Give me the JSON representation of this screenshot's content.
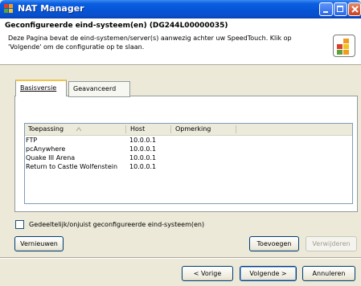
{
  "window": {
    "title": "NAT Manager"
  },
  "header": {
    "title": "Geconfigureerde eind-systeem(en) (DG244L00000035)",
    "description": "Deze Pagina bevat de eind-systemen/server(s) aanwezig achter uw SpeedTouch. Klik op 'Volgende' om de configuratie op te slaan."
  },
  "tabs": [
    {
      "label": "Basisversie",
      "active": true
    },
    {
      "label": "Geavanceerd",
      "active": false
    }
  ],
  "table": {
    "columns": [
      "Toepassing",
      "Host",
      "Opmerking"
    ],
    "rows": [
      {
        "app": "FTP",
        "host": "10.0.0.1",
        "note": ""
      },
      {
        "app": "pcAnywhere",
        "host": "10.0.0.1",
        "note": ""
      },
      {
        "app": "Quake III Arena",
        "host": "10.0.0.1",
        "note": ""
      },
      {
        "app": "Return to Castle Wolfenstein",
        "host": "10.0.0.1",
        "note": ""
      }
    ]
  },
  "checkbox": {
    "label": "Gedeeltelijk/onjuist geconfigureerde eind-systeem(en)",
    "checked": false
  },
  "buttons": {
    "refresh": "Vernieuwen",
    "add": "Toevoegen",
    "remove": "Verwijderen",
    "back": "< Vorige",
    "next": "Volgende >",
    "cancel": "Annuleren"
  },
  "colors": {
    "titlebar": "#0654d6",
    "accent_tab": "#f2c34b",
    "logo_red": "#d9402b",
    "logo_orange": "#f39a1e",
    "logo_green": "#5ea13a",
    "logo_yellow": "#f2c31b"
  }
}
